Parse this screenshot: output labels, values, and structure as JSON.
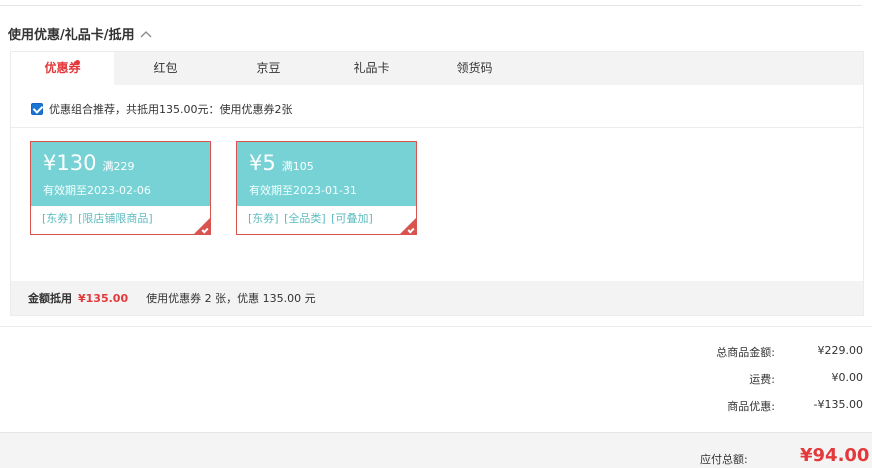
{
  "section": {
    "title": "使用优惠/礼品卡/抵用"
  },
  "tabs": [
    {
      "label": "优惠券"
    },
    {
      "label": "红包"
    },
    {
      "label": "京豆"
    },
    {
      "label": "礼品卡"
    },
    {
      "label": "领货码"
    }
  ],
  "recommend": {
    "text": "优惠组合推荐，共抵用135.00元：使用优惠券2张",
    "checked": true
  },
  "coupons": [
    {
      "amount": "¥130",
      "condition": "满229",
      "valid": "有效期至2023-02-06",
      "tags": "[东券] [限店铺限商品]"
    },
    {
      "amount": "¥5",
      "condition": "满105",
      "valid": "有效期至2023-01-31",
      "tags": "[东券] [全品类] [可叠加]"
    }
  ],
  "discount_bar": {
    "label": "金额抵用",
    "amount": "¥135.00",
    "summary": "使用优惠券 2 张，优惠 135.00 元"
  },
  "totals": [
    {
      "label": "总商品金额:",
      "value": "¥229.00"
    },
    {
      "label": "运费:",
      "value": "¥0.00"
    },
    {
      "label": "商品优惠:",
      "value": "-¥135.00"
    }
  ],
  "payable": {
    "label": "应付总额:",
    "value": "¥94.00"
  },
  "colors": {
    "accent": "#e4393c",
    "coupon": "#77d2d5",
    "tag": "#5dbbbf"
  }
}
